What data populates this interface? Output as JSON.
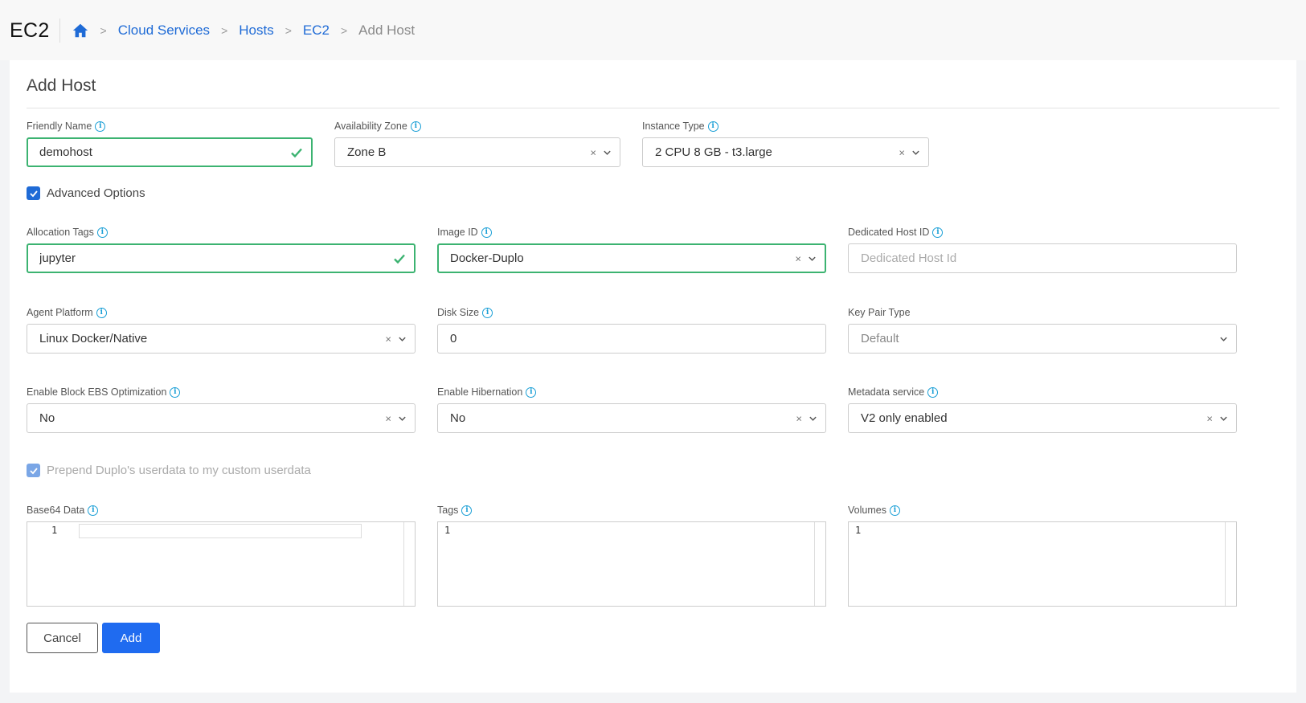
{
  "app": {
    "title": "EC2"
  },
  "breadcrumb": {
    "items": [
      "Cloud Services",
      "Hosts",
      "EC2"
    ],
    "current": "Add Host"
  },
  "form": {
    "title": "Add Host",
    "friendly_name": {
      "label": "Friendly Name",
      "value": "demohost"
    },
    "availability_zone": {
      "label": "Availability Zone",
      "value": "Zone B"
    },
    "instance_type": {
      "label": "Instance Type",
      "value": "2 CPU 8 GB - t3.large"
    },
    "advanced_options": {
      "label": "Advanced Options",
      "checked": true
    },
    "allocation_tags": {
      "label": "Allocation Tags",
      "value": "jupyter"
    },
    "image_id": {
      "label": "Image ID",
      "value": "Docker-Duplo"
    },
    "dedicated_host_id": {
      "label": "Dedicated Host ID",
      "placeholder": "Dedicated Host Id"
    },
    "agent_platform": {
      "label": "Agent Platform",
      "value": "Linux Docker/Native"
    },
    "disk_size": {
      "label": "Disk Size",
      "value": "0"
    },
    "key_pair_type": {
      "label": "Key Pair Type",
      "value": "Default"
    },
    "block_ebs": {
      "label": "Enable Block EBS Optimization",
      "value": "No"
    },
    "hibernation": {
      "label": "Enable Hibernation",
      "value": "No"
    },
    "metadata_service": {
      "label": "Metadata service",
      "value": "V2 only enabled"
    },
    "prepend_userdata": {
      "label": "Prepend Duplo's userdata to my custom userdata",
      "checked": true
    },
    "base64_data": {
      "label": "Base64 Data",
      "line": "1"
    },
    "tags": {
      "label": "Tags",
      "line": "1"
    },
    "volumes": {
      "label": "Volumes",
      "line": "1"
    },
    "cancel_label": "Cancel",
    "add_label": "Add"
  },
  "colors": {
    "primary": "#1f6bf0",
    "valid": "#3cb371",
    "link": "#1f6bd6",
    "info": "#1a9fd6"
  }
}
